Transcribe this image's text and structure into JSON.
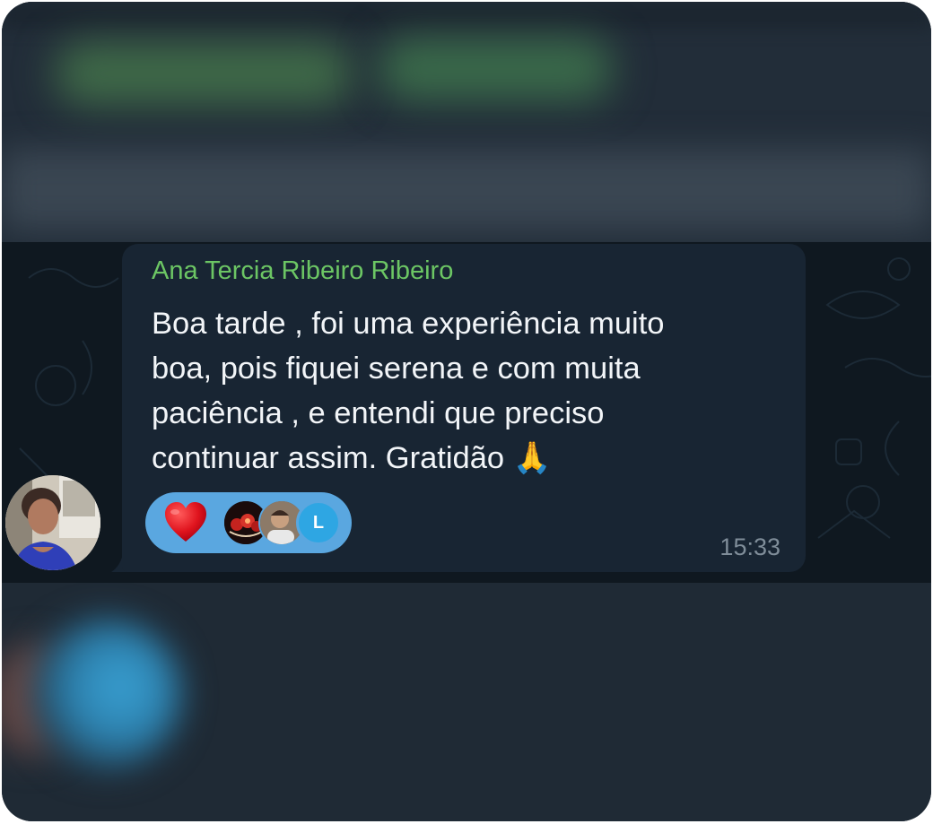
{
  "message": {
    "sender_name": "Ana Tercia Ribeiro Ribeiro",
    "lines": [
      "Boa tarde , foi uma experiência muito",
      "boa, pois fiquei serena e com muita",
      "paciência , e entendi que preciso",
      "continuar assim. Gratidão 🙏"
    ],
    "time": "15:33",
    "sender_color": "#6cc664"
  },
  "reactions": {
    "emoji_icon": "red-heart-icon",
    "reactor_avatars": [
      "avatar-photo",
      "avatar-photo",
      "avatar-initial"
    ],
    "last_reactor_initial": "L",
    "pill_color": "#5aa7e0"
  },
  "colors": {
    "bubble": "#182533",
    "background": "#17212b",
    "timestamp": "#7f8d99"
  }
}
